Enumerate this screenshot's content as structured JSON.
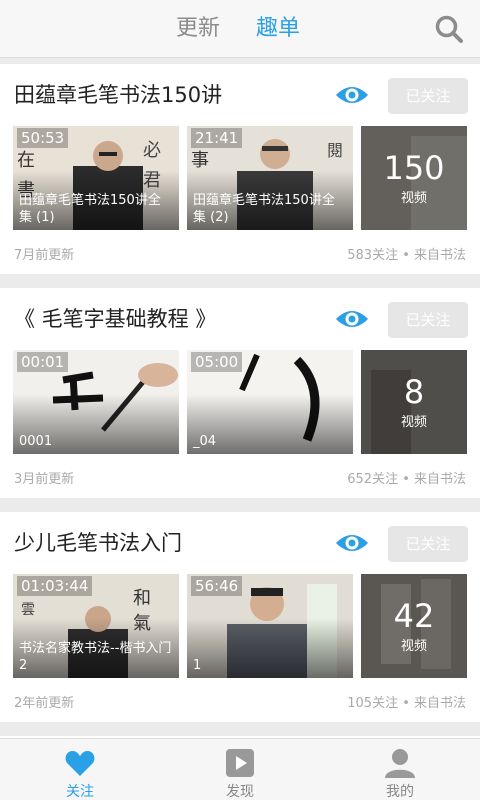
{
  "header": {
    "tabs": [
      {
        "label": "更新",
        "active": false
      },
      {
        "label": "趣单",
        "active": true
      }
    ],
    "search_icon": "search-icon"
  },
  "colors": {
    "accent": "#2aa0e6",
    "inactive": "#8c8c8c",
    "follow_btn_bg": "#e6e6e6"
  },
  "cards": [
    {
      "title": "田蕴章毛笔书法150讲",
      "follow_label": "已关注",
      "thumbs": [
        {
          "duration": "50:53",
          "caption": "田蕴章毛笔书法150讲全集 (1)"
        },
        {
          "duration": "21:41",
          "caption": "田蕴章毛笔书法150讲全集 (2)"
        }
      ],
      "video_count": "150",
      "video_count_label": "视频",
      "updated": "7月前更新",
      "meta": "583关注 • 来自书法"
    },
    {
      "title": "《 毛笔字基础教程 》",
      "follow_label": "已关注",
      "thumbs": [
        {
          "duration": "00:01",
          "caption": "0001"
        },
        {
          "duration": "05:00",
          "caption": "_04"
        }
      ],
      "video_count": "8",
      "video_count_label": "视频",
      "updated": "3月前更新",
      "meta": "652关注 • 来自书法"
    },
    {
      "title": "少儿毛笔书法入门",
      "follow_label": "已关注",
      "thumbs": [
        {
          "duration": "01:03:44",
          "caption": "书法名家教书法--楷书入门2"
        },
        {
          "duration": "56:46",
          "caption": "1"
        }
      ],
      "video_count": "42",
      "video_count_label": "视频",
      "updated": "2年前更新",
      "meta": "105关注 • 来自书法"
    }
  ],
  "bottom_nav": [
    {
      "label": "关注",
      "icon": "heart-icon",
      "active": true
    },
    {
      "label": "发现",
      "icon": "play-icon",
      "active": false
    },
    {
      "label": "我的",
      "icon": "person-icon",
      "active": false
    }
  ]
}
